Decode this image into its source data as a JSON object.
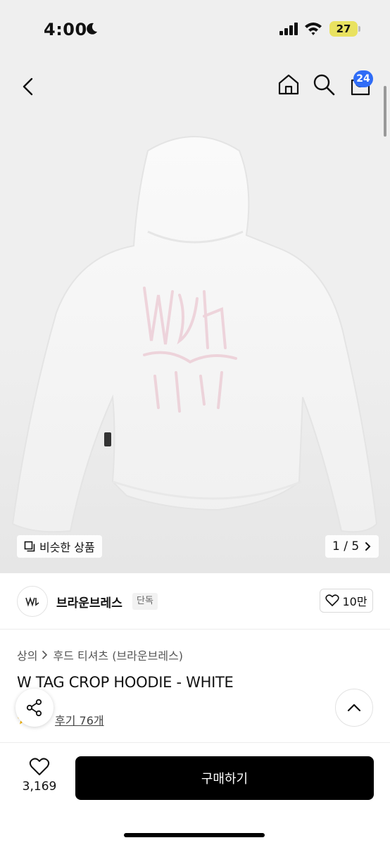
{
  "status": {
    "time": "4:00",
    "battery": "27"
  },
  "nav": {
    "cart_count": "24"
  },
  "gallery": {
    "similar_label": "비슷한 상품",
    "page_indicator": "1 / 5"
  },
  "brand": {
    "name": "브라운브레스",
    "badge": "단독",
    "likes": "10만"
  },
  "product": {
    "breadcrumb": [
      "상의",
      "후드 티셔츠 (브라운브레스)"
    ],
    "title": "W TAG CROP HOODIE - WHITE",
    "review_link": "후기 76개"
  },
  "bottom_bar": {
    "wish_count": "3,169",
    "buy_label": "구매하기"
  },
  "colors": {
    "badge_blue": "#2f6cf6",
    "battery_yellow": "#e9e260",
    "buy_black": "#000000"
  },
  "icons": [
    "moon-icon",
    "signal-icon",
    "wifi-icon",
    "back-icon",
    "home-icon",
    "search-icon",
    "cart-icon",
    "similar-icon",
    "chevron-right-icon",
    "heart-icon",
    "share-icon",
    "chevron-up-icon",
    "star-icon"
  ]
}
